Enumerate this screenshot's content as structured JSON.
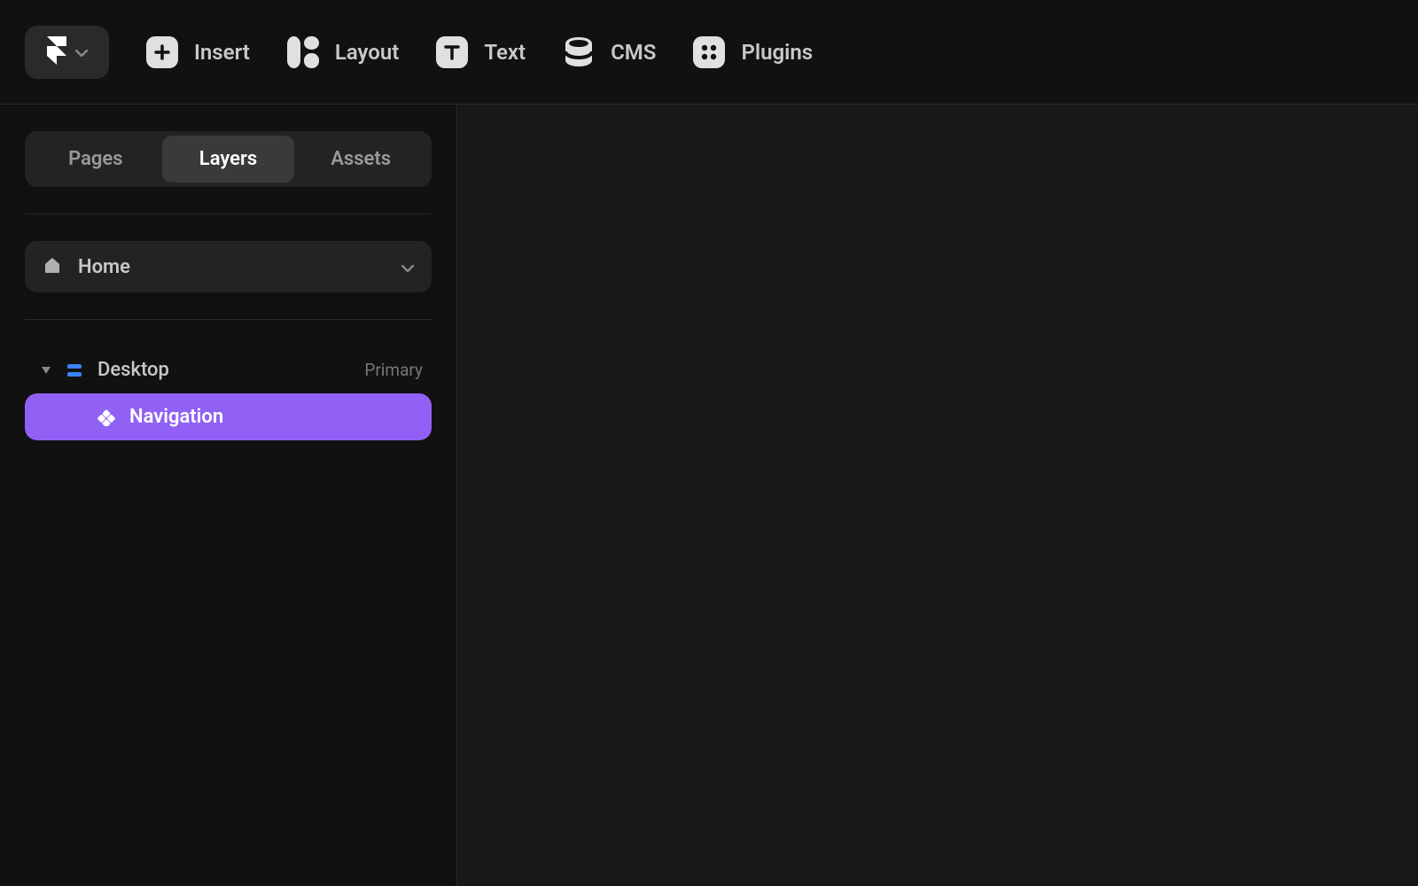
{
  "toolbar": {
    "insert_label": "Insert",
    "layout_label": "Layout",
    "text_label": "Text",
    "cms_label": "CMS",
    "plugins_label": "Plugins"
  },
  "sidebar": {
    "tabs": {
      "pages": "Pages",
      "layers": "Layers",
      "assets": "Assets"
    },
    "page_selector": {
      "label": "Home"
    },
    "layers": {
      "root": {
        "label": "Desktop",
        "badge": "Primary"
      },
      "child": {
        "label": "Navigation"
      }
    }
  }
}
